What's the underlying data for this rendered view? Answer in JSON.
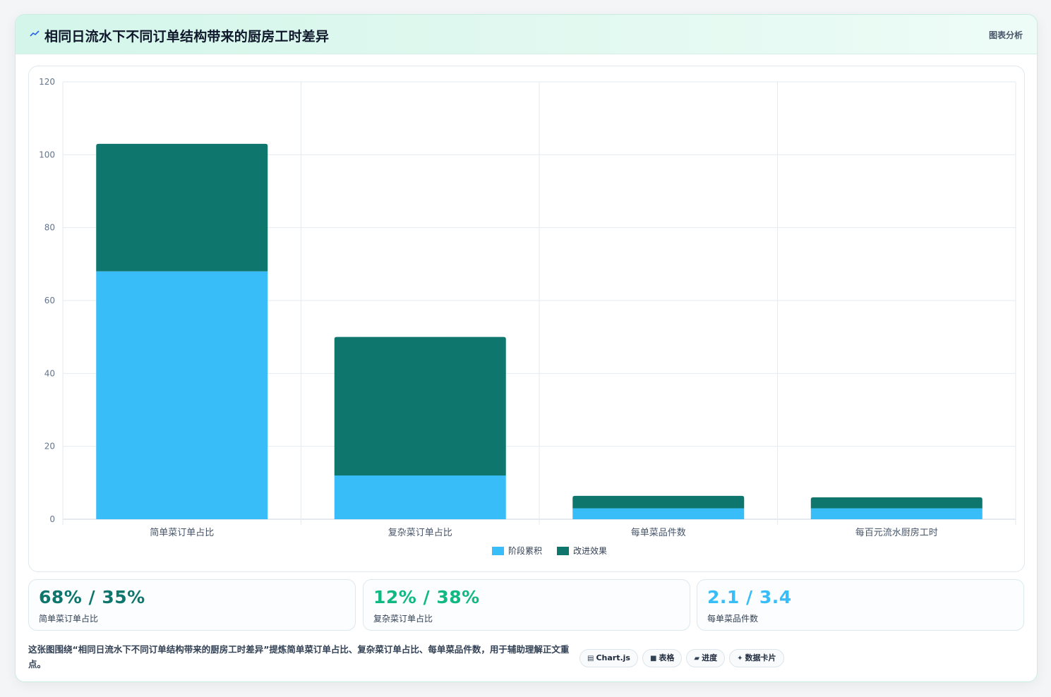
{
  "header": {
    "title": "相同日流水下不同订单结构带来的厨房工时差异",
    "tag": "图表分析",
    "icon": "chart-line-icon"
  },
  "chart_data": {
    "type": "bar",
    "stacked": true,
    "categories": [
      "简单菜订单占比",
      "复杂菜订单占比",
      "每单菜品件数",
      "每百元流水厨房工时"
    ],
    "series": [
      {
        "name": "阶段累积",
        "color": "#38bdf8",
        "values": [
          68,
          12,
          3,
          3
        ]
      },
      {
        "name": "改进效果",
        "color": "#0f766e",
        "values": [
          35,
          38,
          3.4,
          3
        ]
      }
    ],
    "ylim": [
      0,
      120
    ],
    "yticks": [
      0,
      20,
      40,
      60,
      80,
      100,
      120
    ],
    "grid": true,
    "legend": "bottom-center"
  },
  "kpis": [
    {
      "value": "68% / 35%",
      "label": "简单菜订单占比",
      "color": "#0f766e"
    },
    {
      "value": "12% / 38%",
      "label": "复杂菜订单占比",
      "color": "#10b981"
    },
    {
      "value": "2.1 / 3.4",
      "label": "每单菜品件数",
      "color": "#38bdf8"
    }
  ],
  "note": "这张图围绕“相同日流水下不同订单结构带来的厨房工时差异”提炼简单菜订单占比、复杂菜订单占比、每单菜品件数，用于辅助理解正文重点。",
  "chips": [
    {
      "icon": "▤",
      "icon_name": "chart-icon",
      "label": "Chart.js"
    },
    {
      "icon": "■",
      "icon_name": "table-icon",
      "label": "表格"
    },
    {
      "icon": "▰",
      "icon_name": "progress-icon",
      "label": "进度"
    },
    {
      "icon": "✦",
      "icon_name": "card-icon",
      "label": "数据卡片"
    }
  ]
}
